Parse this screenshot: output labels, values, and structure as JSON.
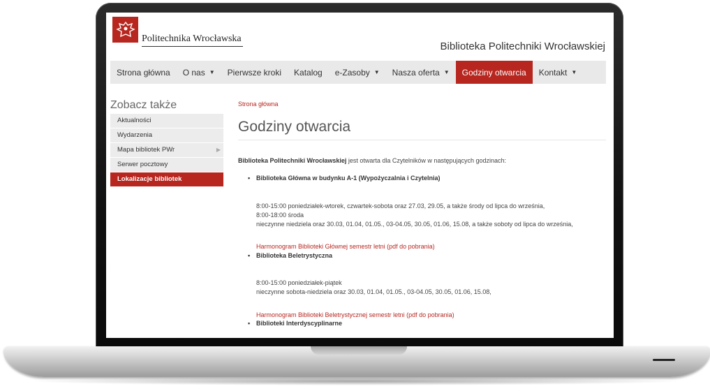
{
  "header": {
    "university_name": "Politechnika Wrocławska",
    "library_title": "Biblioteka Politechniki Wrocławskiej"
  },
  "nav": [
    {
      "label": "Strona główna",
      "dropdown": false,
      "active": false
    },
    {
      "label": "O nas",
      "dropdown": true,
      "active": false
    },
    {
      "label": "Pierwsze kroki",
      "dropdown": false,
      "active": false
    },
    {
      "label": "Katalog",
      "dropdown": false,
      "active": false
    },
    {
      "label": "e-Zasoby",
      "dropdown": true,
      "active": false
    },
    {
      "label": "Nasza oferta",
      "dropdown": true,
      "active": false
    },
    {
      "label": "Godziny otwarcia",
      "dropdown": false,
      "active": true
    },
    {
      "label": "Kontakt",
      "dropdown": true,
      "active": false
    }
  ],
  "sidebar": {
    "title": "Zobacz także",
    "items": [
      {
        "label": "Aktualności"
      },
      {
        "label": "Wydarzenia"
      },
      {
        "label": "Mapa bibliotek PWr"
      },
      {
        "label": "Serwer pocztowy"
      },
      {
        "label": "Lokalizacje bibliotek"
      }
    ]
  },
  "main": {
    "breadcrumb": "Strona główna",
    "page_title": "Godziny otwarcia",
    "intro_bold": "Biblioteka Politechniki Wrocławskiej",
    "intro_rest": " jest otwarta dla Czytelników w następujących godzinach:",
    "sections": [
      {
        "name": "Biblioteka Główna w budynku A-1 (Wypożyczalnia i Czytelnia)",
        "hours": [
          "8:00-15:00 poniedziałek-wtorek, czwartek-sobota oraz 27.03, 29.05, a także środy od lipca do września,",
          "8:00-18:00 środa",
          "nieczynne  niedziela oraz 30.03, 01.04, 01.05., 03-04.05, 30.05, 01.06, 15.08, a także soboty od lipca do września,"
        ],
        "link": "Harmonogram Biblioteki Głównej semestr letni (pdf do pobrania)"
      },
      {
        "name": "Biblioteka Beletrystyczna",
        "hours": [
          "8:00-15:00 poniedziałek-piątek",
          "nieczynne  sobota-niedziela oraz 30.03, 01.04, 01.05., 03-04.05, 30.05, 01.06, 15.08,"
        ],
        "link": "Harmonogram Biblioteki Beletrystycznej semestr letni (pdf do pobrania)"
      },
      {
        "name": "Biblioteki Interdyscyplinarne"
      }
    ]
  },
  "colors": {
    "accent": "#b7261f",
    "nav_bg": "#e9e9e9"
  }
}
